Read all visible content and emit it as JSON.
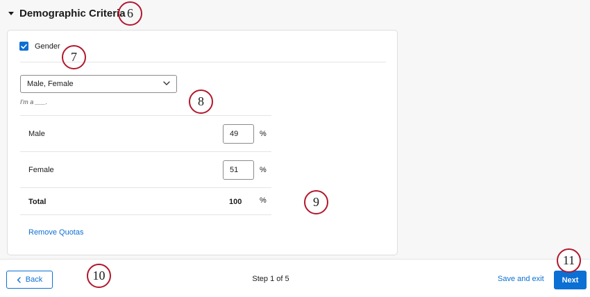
{
  "section": {
    "title": "Demographic Criteria"
  },
  "criteria": {
    "checkbox_label": "Gender",
    "checked": true,
    "select_value": "Male, Female",
    "hint": "I'm a ___."
  },
  "quotas": {
    "rows": [
      {
        "label": "Male",
        "value": "49",
        "unit": "%"
      },
      {
        "label": "Female",
        "value": "51",
        "unit": "%"
      }
    ],
    "total": {
      "label": "Total",
      "value": "100",
      "unit": "%"
    },
    "remove_label": "Remove Quotas"
  },
  "footer": {
    "back_label": "Back",
    "step_text": "Step 1 of 5",
    "save_exit_label": "Save and exit",
    "next_label": "Next"
  },
  "callouts": [
    "6",
    "7",
    "8",
    "9",
    "10",
    "11"
  ],
  "colors": {
    "accent": "#0b6fd4",
    "callout": "#b3162b"
  }
}
